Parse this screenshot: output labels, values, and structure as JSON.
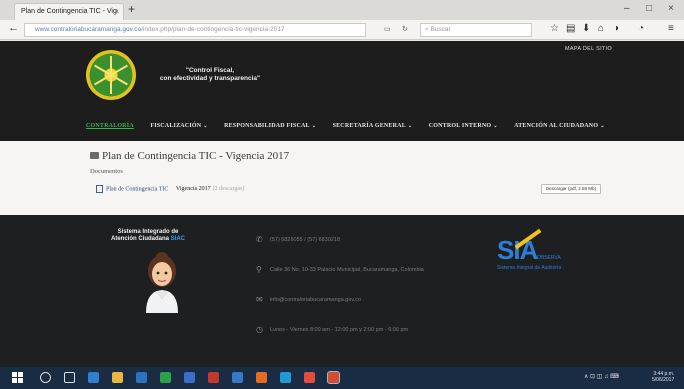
{
  "browser": {
    "tab_title": "Plan de Contingencia TIC - Vig",
    "tab_close": "×",
    "new_tab": "+",
    "window_controls": [
      "–",
      "□",
      "×"
    ],
    "url_host": "www.contraloriabucaramanga.gov.co",
    "url_path": "/index.php/plan-de-contingencia-tic-vigencia-2017",
    "search_placeholder": "Buscar",
    "toolbar_icons": [
      "star-icon",
      "bookmarks-icon",
      "download-icon",
      "home-icon",
      "pocket-icon",
      "menu-icon"
    ]
  },
  "header": {
    "site_map": "MAPA DEL SITIO",
    "slogan_line1": "\"Control Fiscal,",
    "slogan_line2": "con efectividad y transparencia\"",
    "menu": [
      {
        "label": "CONTRALORÍA",
        "active": true,
        "has_dropdown": false
      },
      {
        "label": "FISCALIZACIÓN",
        "active": false,
        "has_dropdown": true
      },
      {
        "label": "RESPONSABILIDAD FISCAL",
        "active": false,
        "has_dropdown": true
      },
      {
        "label": "SECRETARÍA GENERAL",
        "active": false,
        "has_dropdown": true
      },
      {
        "label": "CONTROL INTERNO",
        "active": false,
        "has_dropdown": true
      },
      {
        "label": "ATENCIÓN AL CIUDADANO",
        "active": false,
        "has_dropdown": true
      }
    ]
  },
  "content": {
    "page_title": "Plan de Contingencia TIC - Vigencia 2017",
    "documents_label": "Documentos",
    "document": {
      "name": "Plan de Contingencia TIC",
      "suffix": "Vigencia 2017",
      "size": "(2 descargas)",
      "download_label": "Descargar (pdf, 2.58 Mb)"
    }
  },
  "footer": {
    "sistema_line1": "Sistema Integrado de",
    "sistema_line2": "Atención Ciudadana",
    "sistema_acronym": "SIAC",
    "phone": "(57) 6826055 / (57) 6830218",
    "address": "Calle 36 No. 10-33 Palacio Municipal, Bucaramanga, Colombia",
    "email": "info@contraloriabucaramanga.gov.co",
    "hours": "Lunes - Viernes 8:00 am - 12:00 pm y 2:00 pm - 6:00 pm",
    "sia_brand": "SIA",
    "sia_sub1": "OBSERVA",
    "sia_sub2": "Sistema Integral de Auditoría"
  },
  "taskbar": {
    "clock_time": "3:44 p.m.",
    "clock_date": "5/06/2017",
    "tray": "∧ ⊡ ◫ ♫ ⌨"
  },
  "colors": {
    "header_bg": "#1d1d1d",
    "accent_green": "#3cb14a",
    "sia_blue": "#2d7fd6",
    "sia_yellow": "#f2c41a",
    "taskbar_bg": "#1a2b44"
  }
}
